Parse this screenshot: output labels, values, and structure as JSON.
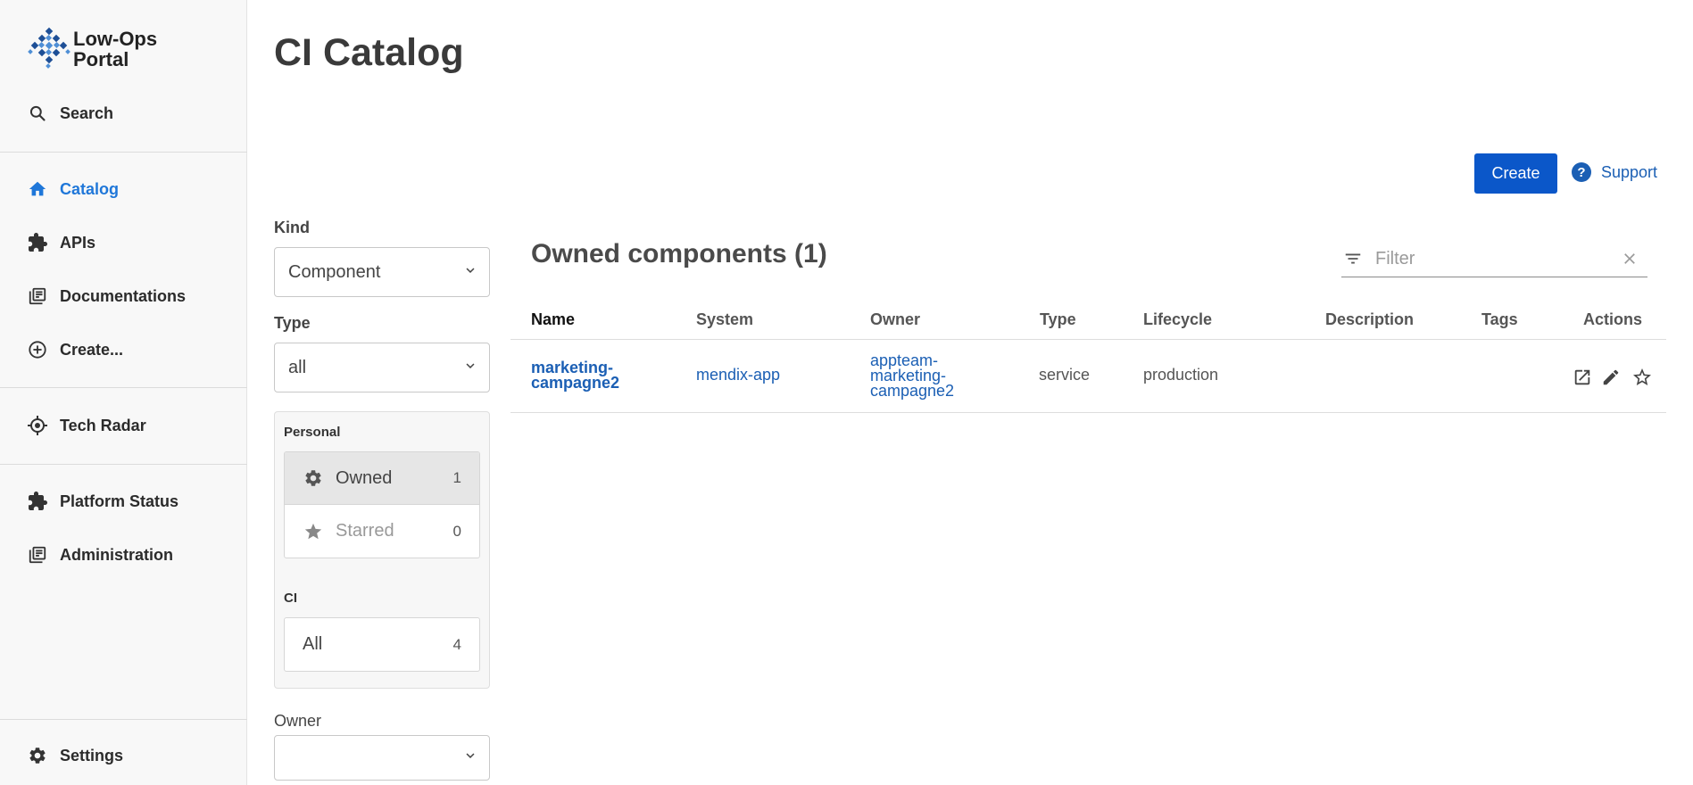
{
  "app": {
    "logo_line1": "Low-Ops",
    "logo_line2": "Portal"
  },
  "sidebar": {
    "search_label": "Search",
    "items": [
      {
        "label": "Catalog",
        "icon": "home-icon",
        "active": true
      },
      {
        "label": "APIs",
        "icon": "puzzle-icon"
      },
      {
        "label": "Documentations",
        "icon": "library-books-icon"
      },
      {
        "label": "Create...",
        "icon": "add-circle-icon"
      },
      {
        "label": "Tech Radar",
        "icon": "radar-icon"
      },
      {
        "label": "Platform Status",
        "icon": "puzzle-icon"
      },
      {
        "label": "Administration",
        "icon": "library-books-icon"
      }
    ],
    "settings_label": "Settings"
  },
  "header": {
    "title": "CI Catalog",
    "create_label": "Create",
    "support_label": "Support",
    "support_icon_glyph": "?"
  },
  "filters": {
    "kind_label": "Kind",
    "kind_value": "Component",
    "type_label": "Type",
    "type_value": "all",
    "personal_heading": "Personal",
    "owned_label": "Owned",
    "owned_count": "1",
    "starred_label": "Starred",
    "starred_count": "0",
    "ci_heading": "CI",
    "all_label": "All",
    "all_count": "4",
    "owner_label": "Owner",
    "owner_value": ""
  },
  "table": {
    "title": "Owned components (1)",
    "filter_placeholder": "Filter",
    "columns": [
      "Name",
      "System",
      "Owner",
      "Type",
      "Lifecycle",
      "Description",
      "Tags",
      "Actions"
    ],
    "rows": [
      {
        "name_line1": "marketing-",
        "name_line2": "campagne2",
        "system": "mendix-app",
        "owner_line1": "appteam-",
        "owner_line2": "marketing-",
        "owner_line3": "campagne2",
        "type": "service",
        "lifecycle": "production",
        "description": "",
        "tags": ""
      }
    ]
  },
  "colors": {
    "accent": "#1f77d9",
    "primary_button": "#0b57c9",
    "link": "#1b5fb4",
    "sidebar_bg": "#f8f8f8"
  }
}
